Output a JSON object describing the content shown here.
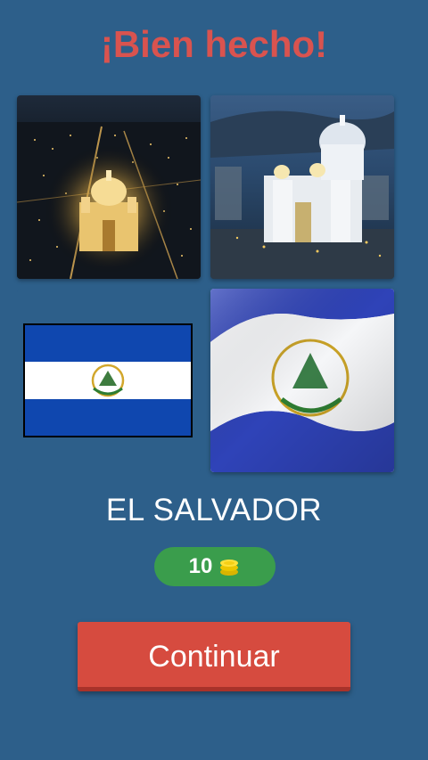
{
  "header": {
    "title": "¡Bien hecho!"
  },
  "tiles": [
    {
      "name": "night-aerial-cathedral-photo"
    },
    {
      "name": "cathedral-dusk-photo"
    },
    {
      "name": "el-salvador-flag-image"
    },
    {
      "name": "waving-el-salvador-flag-photo"
    }
  ],
  "result": {
    "answer": "EL SALVADOR"
  },
  "reward": {
    "coins": "10",
    "icon": "coin-stack-icon"
  },
  "actions": {
    "continue_label": "Continuar"
  },
  "colors": {
    "background": "#2d5f8a",
    "title": "#d9534f",
    "coins_pill": "#3a9d4c",
    "button": "#d64b3f",
    "flag_blue": "#0f47af"
  }
}
